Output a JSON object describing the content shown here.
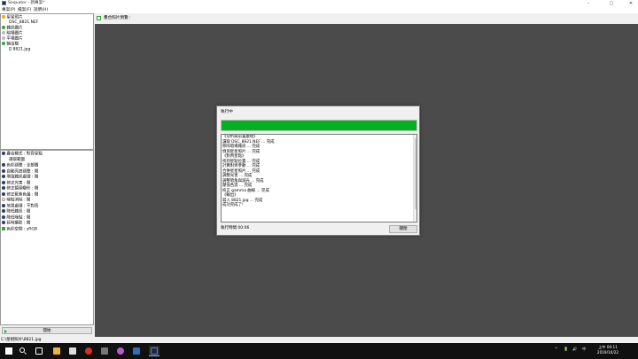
{
  "window": {
    "title": "Sequator - 新專案*",
    "minimize": "–",
    "maximize": "▢",
    "close": "✕"
  },
  "menu": [
    "專案(P)",
    "檔案(F)",
    "說明(H)"
  ],
  "tree": [
    {
      "label": "星星照片",
      "icon": "folder",
      "indent": 0
    },
    {
      "label": "DSC_8821.NEF",
      "icon": "none",
      "indent": 1
    },
    {
      "label": "雜訊圖片",
      "icon": "ok",
      "indent": 0
    },
    {
      "label": "暗場圖片",
      "icon": "gray",
      "indent": 0
    },
    {
      "label": "平場圖片",
      "icon": "gray",
      "indent": 0
    },
    {
      "label": "輸出檔",
      "icon": "ok",
      "indent": 0
    },
    {
      "label": "8821.jpg",
      "icon": "file",
      "indent": 1
    }
  ],
  "properties": [
    {
      "label": "疊合模式 : 對齊星點",
      "icon": "blue"
    },
    {
      "label": "選取範圍",
      "icon": "none",
      "indent": true
    },
    {
      "label": "色彩調整 : 全部圖",
      "icon": "blue"
    },
    {
      "label": "自動亮度調整 : 開",
      "icon": "blue"
    },
    {
      "label": "增強雜訊處理 : 開",
      "icon": "blue"
    },
    {
      "label": "修正光害 : 開",
      "icon": "blue"
    },
    {
      "label": "修正鏡頭變形 : 開",
      "icon": "blue"
    },
    {
      "label": "修正藍紫色邊 : 開",
      "icon": "blue"
    },
    {
      "label": "噪點消除 : 開",
      "icon": "dim"
    },
    {
      "label": "地景處理 : 不對齊",
      "icon": "blue"
    },
    {
      "label": "降低雜訊 : 開",
      "icon": "blue"
    },
    {
      "label": "降低噪點 : 開",
      "icon": "blue"
    },
    {
      "label": "延時攝影 : 開",
      "icon": "blue"
    },
    {
      "label": "色彩空間 : sRGB",
      "icon": "green"
    }
  ],
  "start_button": "開始",
  "status_bar": "C:\\星相照片\\8821.jpg",
  "right_header": "疊合照片預覽 :",
  "dialog": {
    "title": "執行中",
    "progress": 1.0,
    "log": [
      "《分析與前置處理》",
      "讀取 DSC_8821.NEF ... 完成",
      "移除暗場雜訊 ... 完成",
      "偵測星星照片 ... 完成",
      "《對齊星點》",
      "找到星點位置 ... 完成",
      "計算對齊參數 ... 完成",
      "合併星星照片 ... 完成",
      "調整光害 ... 完成",
      "調整暗角與減光 ... 完成",
      "壓低色溫 ... 完成",
      "校正 gamma 曲線 ... 完成",
      "《輸出》",
      "寫入 8821.jpg ... 完成",
      "成功完成了!"
    ],
    "elapsed_label": "執行時間 00:06",
    "close_label": "關閉"
  },
  "taskbar": {
    "clock_time": "上午 00:11",
    "clock_date": "2019/10/22",
    "tray_icons": [
      "^",
      "🔋",
      "🔊",
      "中"
    ]
  },
  "colors": {
    "canvas": "#4b4b4b",
    "progress_green": "#06b025",
    "taskbar": "#101010"
  }
}
